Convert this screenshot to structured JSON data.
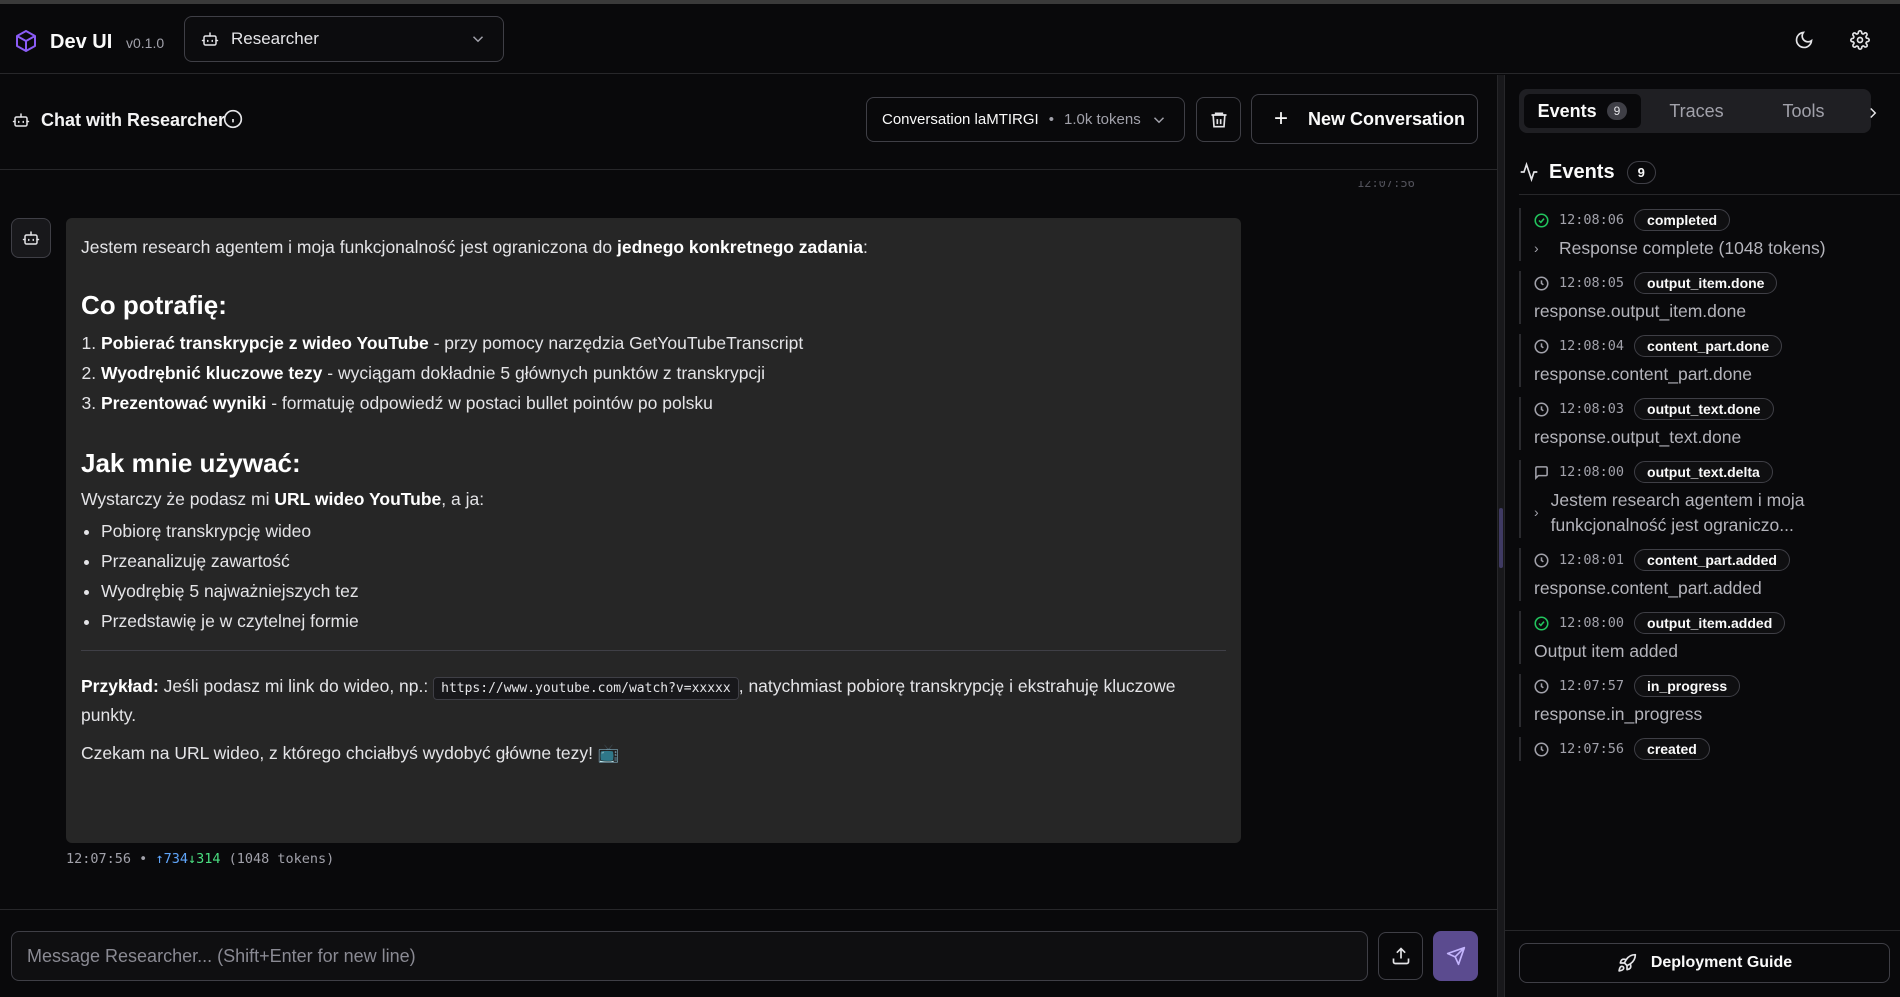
{
  "app": {
    "name": "Dev UI",
    "version": "v0.1.0",
    "accent": "#8b5cf6"
  },
  "agent_selector": {
    "value": "Researcher"
  },
  "chat": {
    "title": "Chat with Researcher",
    "conversation": {
      "name": "Conversation laMTIRGI",
      "tokens": "1.0k tokens"
    },
    "new_conversation_label": "New Conversation"
  },
  "message": {
    "intro_pre": "Jestem research agentem i moja funkcjonalność jest ograniczona do ",
    "intro_bold": "jednego konkretnego zadania",
    "intro_post": ":",
    "h1": "Co potrafię:",
    "capabilities": [
      {
        "bold": "Pobierać transkrypcje z wideo YouTube",
        "text": " - przy pomocy narzędzia GetYouTubeTranscript"
      },
      {
        "bold": "Wyodrębnić kluczowe tezy",
        "text": " - wyciągam dokładnie 5 głównych punktów z transkrypcji"
      },
      {
        "bold": "Prezentować wyniki",
        "text": " - formatuję odpowiedź w postaci bullet pointów po polsku"
      }
    ],
    "h2": "Jak mnie używać:",
    "usage_pre": "Wystarczy że podasz mi ",
    "usage_bold": "URL wideo YouTube",
    "usage_post": ", a ja:",
    "steps": [
      "Pobiorę transkrypcję wideo",
      "Przeanalizuję zawartość",
      "Wyodrębię 5 najważniejszych tez",
      "Przedstawię je w czytelnej formie"
    ],
    "example_label": "Przykład:",
    "example_pre": " Jeśli podasz mi link do wideo, np.: ",
    "example_code": "https://www.youtube.com/watch?v=xxxxx",
    "example_post": ", natychmiast pobiorę transkrypcję i ekstrahuję kluczowe punkty.",
    "closing": "Czekam na URL wideo, z którego chciałbyś wydobyć główne tezy! 📺",
    "meta_time": "12:07:56",
    "meta_sep": "•",
    "meta_up": "↑734",
    "meta_down": "↓314",
    "meta_total": "(1048 tokens)"
  },
  "input": {
    "placeholder": "Message Researcher... (Shift+Enter for new line)",
    "value": ""
  },
  "panel": {
    "tabs": [
      {
        "label": "Events",
        "badge": "9"
      },
      {
        "label": "Traces"
      },
      {
        "label": "Tools"
      }
    ],
    "events_title": "Events",
    "events_count": "9",
    "events": [
      {
        "time": "12:08:06",
        "type": "completed",
        "desc": "Response complete (1048 tokens)",
        "icon": "check-circle-icon",
        "expandable": true
      },
      {
        "time": "12:08:05",
        "type": "output_item.done",
        "desc": "response.output_item.done",
        "icon": "clock-icon"
      },
      {
        "time": "12:08:04",
        "type": "content_part.done",
        "desc": "response.content_part.done",
        "icon": "clock-icon"
      },
      {
        "time": "12:08:03",
        "type": "output_text.done",
        "desc": "response.output_text.done",
        "icon": "clock-icon"
      },
      {
        "time": "12:08:00",
        "type": "output_text.delta",
        "desc": "Jestem research agentem i moja funkcjonalność jest ograniczo...",
        "icon": "message-icon",
        "expandable": true
      },
      {
        "time": "12:08:01",
        "type": "content_part.added",
        "desc": "response.content_part.added",
        "icon": "clock-icon"
      },
      {
        "time": "12:08:00",
        "type": "output_item.added",
        "desc": "Output item added",
        "icon": "check-circle-icon"
      },
      {
        "time": "12:07:57",
        "type": "in_progress",
        "desc": "response.in_progress",
        "icon": "clock-icon"
      },
      {
        "time": "12:07:56",
        "type": "created",
        "desc": "",
        "icon": "clock-icon"
      }
    ],
    "deploy_label": "Deployment Guide"
  }
}
